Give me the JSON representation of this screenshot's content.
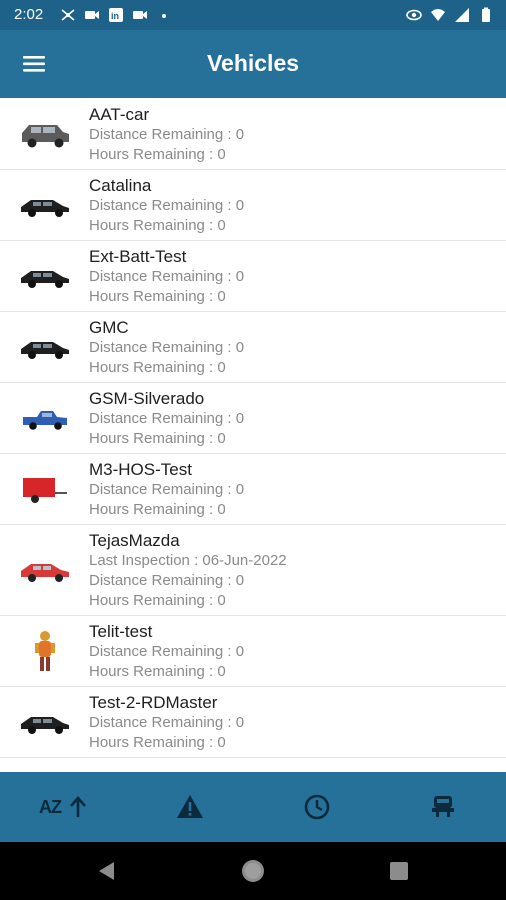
{
  "status_bar": {
    "time": "2:02",
    "left_icons": [
      "network-icon",
      "video-icon",
      "linkedin-icon",
      "video-icon",
      "dot-icon"
    ],
    "right_icons": [
      "eye-icon",
      "wifi-icon",
      "signal-icon",
      "battery-icon"
    ]
  },
  "app_bar": {
    "title": "Vehicles",
    "menu_icon": "hamburger-menu-icon",
    "color": "#25719a"
  },
  "vehicles": [
    {
      "name": "AAT-car",
      "icon": "suv-icon",
      "lines": [
        "Distance Remaining : 0",
        "Hours Remaining : 0"
      ]
    },
    {
      "name": "Catalina",
      "icon": "car-icon",
      "lines": [
        "Distance Remaining : 0",
        "Hours Remaining : 0"
      ]
    },
    {
      "name": "Ext-Batt-Test",
      "icon": "car-icon",
      "lines": [
        "Distance Remaining : 0",
        "Hours Remaining : 0"
      ]
    },
    {
      "name": "GMC",
      "icon": "car-icon",
      "lines": [
        "Distance Remaining : 0",
        "Hours Remaining : 0"
      ]
    },
    {
      "name": "GSM-Silverado",
      "icon": "pickup-truck-icon",
      "lines": [
        "Distance Remaining : 0",
        "Hours Remaining : 0"
      ]
    },
    {
      "name": "M3-HOS-Test",
      "icon": "trailer-icon",
      "lines": [
        "Distance Remaining : 0",
        "Hours Remaining : 0"
      ]
    },
    {
      "name": "TejasMazda",
      "icon": "red-car-icon",
      "lines": [
        "Last Inspection : 06-Jun-2022",
        "Distance Remaining : 0",
        "Hours Remaining : 0"
      ]
    },
    {
      "name": "Telit-test",
      "icon": "person-icon",
      "lines": [
        "Distance Remaining : 0",
        "Hours Remaining : 0"
      ]
    },
    {
      "name": "Test-2-RDMaster",
      "icon": "car-icon",
      "lines": [
        "Distance Remaining : 0",
        "Hours Remaining : 0"
      ]
    }
  ],
  "bottom_nav": {
    "sort_label": "AZ",
    "items": [
      "sort-az-icon",
      "warning-icon",
      "clock-icon",
      "vehicle-icon"
    ]
  }
}
